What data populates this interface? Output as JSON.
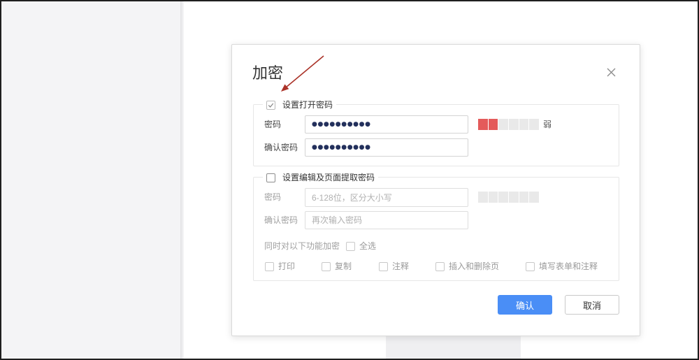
{
  "colors": {
    "accent": "#4a8ef6",
    "strength_weak": "#e45b5b",
    "strength_empty": "#e9e9e9",
    "arrow": "#ab3329"
  },
  "dialog": {
    "title": "加密",
    "close_icon": "close-icon"
  },
  "open_password": {
    "enabled": true,
    "label": "设置打开密码",
    "password_label": "密码",
    "password_value": "●●●●●●●●●●",
    "confirm_label": "确认密码",
    "confirm_value": "●●●●●●●●●●",
    "strength": {
      "segments": 6,
      "filled": 2,
      "text": "弱"
    }
  },
  "edit_password": {
    "enabled": false,
    "label": "设置编辑及页面提取密码",
    "password_label": "密码",
    "password_placeholder": "6-128位，区分大小写",
    "confirm_label": "确认密码",
    "confirm_placeholder": "再次输入密码",
    "strength": {
      "segments": 6,
      "filled": 0
    },
    "functions_label": "同时对以下功能加密",
    "select_all": {
      "label": "全选",
      "checked": false
    },
    "options": [
      {
        "label": "打印",
        "checked": false
      },
      {
        "label": "复制",
        "checked": false
      },
      {
        "label": "注释",
        "checked": false
      },
      {
        "label": "插入和删除页",
        "checked": false
      },
      {
        "label": "填写表单和注释",
        "checked": false
      }
    ]
  },
  "buttons": {
    "confirm": "确认",
    "cancel": "取消"
  }
}
